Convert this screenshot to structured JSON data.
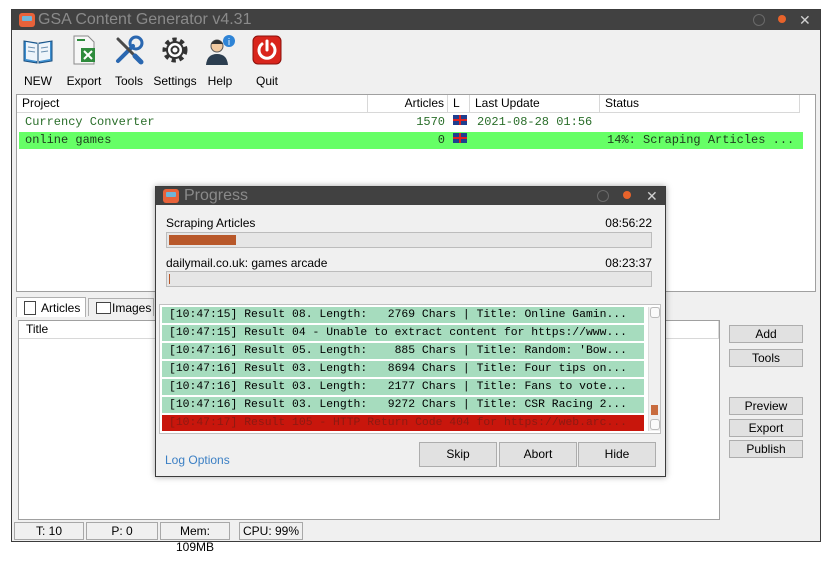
{
  "window": {
    "title": "GSA Content Generator v4.31"
  },
  "toolbar": [
    {
      "label": "NEW",
      "icon": "book-icon"
    },
    {
      "label": "Export",
      "icon": "excel-export-icon"
    },
    {
      "label": "Tools",
      "icon": "wrench-screwdriver-icon"
    },
    {
      "label": "Settings",
      "icon": "gear-icon"
    },
    {
      "label": "Help",
      "icon": "support-person-icon"
    },
    {
      "label": "Quit",
      "icon": "power-icon"
    }
  ],
  "projects": {
    "columns": [
      "Project",
      "Articles",
      "L",
      "Last Update",
      "Status"
    ],
    "rows": [
      {
        "project": "Currency Converter",
        "articles": "1570",
        "lang": "en-GB",
        "last_update": "2021-08-28 01:56",
        "status": ""
      },
      {
        "project": "online games",
        "articles": "0",
        "lang": "en-GB",
        "last_update": "",
        "status": "14%: Scraping Articles ...",
        "selected": true
      }
    ]
  },
  "tabs": [
    {
      "label": "Articles",
      "icon": "articles-icon",
      "active": true
    },
    {
      "label": "Images",
      "icon": "images-icon",
      "active": false
    }
  ],
  "articles_list": {
    "columns": [
      "Title"
    ]
  },
  "side_buttons": {
    "add": "Add",
    "tools": "Tools",
    "preview": "Preview",
    "export": "Export",
    "publish": "Publish"
  },
  "statusbar": {
    "threads": "T: 10",
    "projects": "P: 0",
    "memory": "Mem: 109MB",
    "cpu": "CPU: 99%"
  },
  "progress_dialog": {
    "title": "Progress",
    "task1": {
      "label": "Scraping Articles",
      "time": "08:56:22",
      "progress": 0.14
    },
    "task2": {
      "label": "dailymail.co.uk: games arcade",
      "time": "08:23:37",
      "progress": 0.0
    },
    "log": [
      {
        "text": "[10:47:15] Result 08. Length:   2769 Chars | Title: Online Gamin...",
        "type": "ok"
      },
      {
        "text": "[10:47:15] Result 04 - Unable to extract content for https://www...",
        "type": "ok"
      },
      {
        "text": "[10:47:16] Result 05. Length:    885 Chars | Title: Random: 'Bow...",
        "type": "ok"
      },
      {
        "text": "[10:47:16] Result 03. Length:   8694 Chars | Title: Four tips on...",
        "type": "ok"
      },
      {
        "text": "[10:47:16] Result 03. Length:   2177 Chars | Title: Fans to vote...",
        "type": "ok"
      },
      {
        "text": "[10:47:16] Result 03. Length:   9272 Chars | Title: CSR Racing 2...",
        "type": "ok"
      },
      {
        "text": "[10:47:17] Result 105 - HTTP Return Code 404 for https://web.arc...",
        "type": "error"
      }
    ],
    "log_options": "Log Options",
    "skip": "Skip",
    "abort": "Abort",
    "hide": "Hide"
  },
  "colors": {
    "titlebar": "#414141",
    "selected_row": "#66ff66",
    "log_ok": "#a6dcbe",
    "log_error": "#c8160c",
    "progress_fill": "#b8582a",
    "link": "#3b7fc4"
  }
}
